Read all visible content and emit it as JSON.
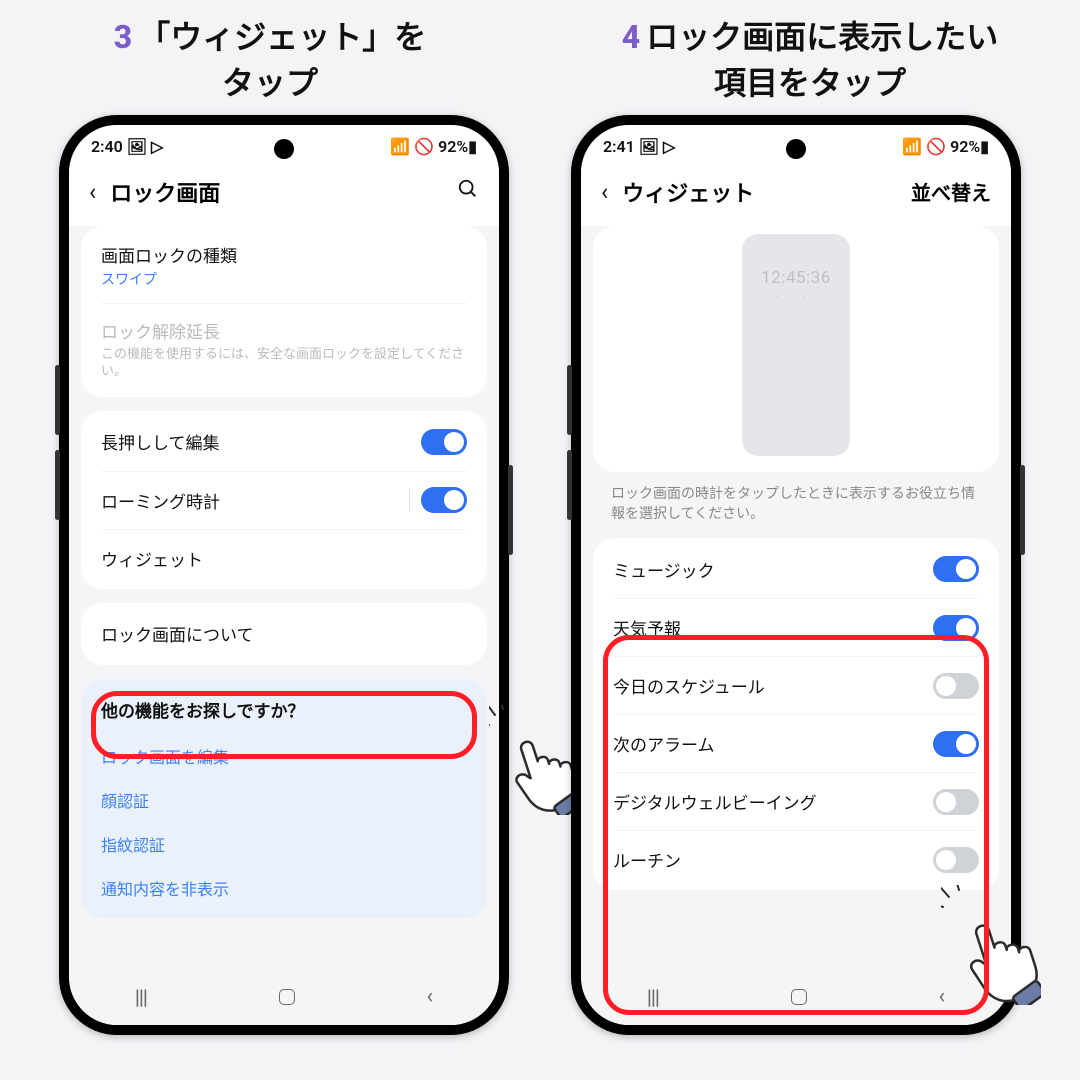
{
  "instructions": {
    "left_num": "3",
    "left_text_l1": "「ウィジェット」を",
    "left_text_l2": "タップ",
    "right_num": "4",
    "right_text_l1": "ロック画面に表示したい",
    "right_text_l2": "項目をタップ"
  },
  "phone_left": {
    "status": {
      "time": "2:40",
      "icons": "🖼 ▷",
      "right": "📶 🚫 92%▮"
    },
    "appbar": {
      "title": "ロック画面"
    },
    "section1": {
      "lock_type_title": "画面ロックの種類",
      "lock_type_value": "スワイプ",
      "extend_title": "ロック解除延長",
      "extend_hint": "この機能を使用するには、安全な画面ロックを設定してください。"
    },
    "section2": {
      "long_press": "長押しして編集",
      "roaming": "ローミング時計",
      "widgets": "ウィジェット"
    },
    "section3": {
      "about": "ロック画面について"
    },
    "extra": {
      "title": "他の機能をお探しですか？",
      "links": [
        "ロック画面を編集",
        "顔認証",
        "指紋認証",
        "通知内容を非表示"
      ]
    }
  },
  "phone_right": {
    "status": {
      "time": "2:41",
      "icons": "🖼 ▷",
      "right": "📶 🚫 92%▮"
    },
    "appbar": {
      "title": "ウィジェット",
      "action": "並べ替え"
    },
    "preview_time": "12:45:36",
    "helper": "ロック画面の時計をタップしたときに表示するお役立ち情報を選択してください。",
    "items": [
      {
        "label": "ミュージック",
        "on": true
      },
      {
        "label": "天気予報",
        "on": true
      },
      {
        "label": "今日のスケジュール",
        "on": false
      },
      {
        "label": "次のアラーム",
        "on": true
      },
      {
        "label": "デジタルウェルビーイング",
        "on": false
      },
      {
        "label": "ルーチン",
        "on": false
      }
    ]
  }
}
